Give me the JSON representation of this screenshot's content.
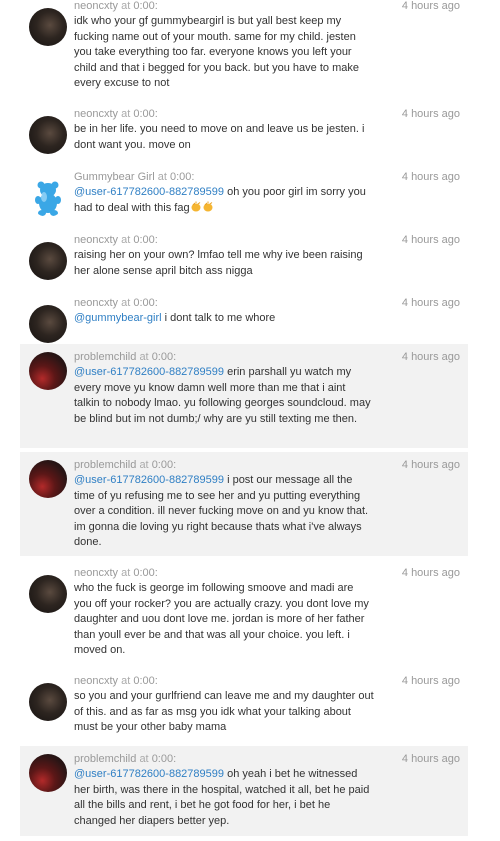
{
  "comments": [
    {
      "author": "neoncxty",
      "at": "at",
      "time": "0:00",
      "ago": "4 hours ago",
      "text": "idk who your gf gummybeargirl is but yall best keep my fucking name out of your mouth. same for my child. jesten you take everything too far. everyone knows you left your child and that i begged for you back. but you have to make every excuse to not"
    },
    {
      "author": "neoncxty",
      "at": "at",
      "time": "0:00",
      "ago": "4 hours ago",
      "text": "be in her life. you need to move on and leave us be jesten. i dont want you. move on"
    },
    {
      "author": "Gummybear Girl",
      "at": "at",
      "time": "0:00",
      "ago": "4 hours ago",
      "mention": "@user-617782600-882789599",
      "text": " oh you poor girl im sorry you had to deal with this fag"
    },
    {
      "author": "neoncxty",
      "at": "at",
      "time": "0:00",
      "ago": "4 hours ago",
      "text": "raising her on your own? lmfao tell me why ive been raising her alone sense april bitch ass nigga"
    },
    {
      "author": "neoncxty",
      "at": "at",
      "time": "0:00",
      "ago": "4 hours ago",
      "mention": "@gummybear-girl",
      "text": " i dont talk to me whore"
    },
    {
      "author": "problemchild",
      "at": "at",
      "time": "0:00",
      "ago": "4 hours ago",
      "mention": "@user-617782600-882789599",
      "text": " erin parshall yu watch my every move yu know damn well more than me that i aint talkin to nobody lmao. yu following georges soundcloud. may be blind but im not dumb;/ why are yu still texting me then."
    },
    {
      "author": "problemchild",
      "at": "at",
      "time": "0:00",
      "ago": "4 hours ago",
      "mention": "@user-617782600-882789599",
      "text": " i post our message all the time of yu refusing me to see her and yu putting everything over a condition. ill never fucking move on and yu know that. im gonna die loving yu right because thats what i've always done."
    },
    {
      "author": "neoncxty",
      "at": "at",
      "time": "0:00",
      "ago": "4 hours ago",
      "text": "who the fuck is george im following smoove and madi are you off your rocker? you are actually crazy. you dont love my daughter and uou dont love me. jordan is more of her father than youll ever be and that was all your choice. you left. i moved on."
    },
    {
      "author": "neoncxty",
      "at": "at",
      "time": "0:00",
      "ago": "4 hours ago",
      "text": "so you and your gurlfriend can leave me and my daughter out of this. and as far as msg you idk what your talking about must be your other baby mama"
    },
    {
      "author": "problemchild",
      "at": "at",
      "time": "0:00",
      "ago": "4 hours ago",
      "mention": "@user-617782600-882789599",
      "text": " oh yeah i bet he witnessed her birth, was there in the hospital, watched it all, bet he paid all the bills and rent, i bet he got food for her, i bet he changed her diapers better yep."
    }
  ]
}
